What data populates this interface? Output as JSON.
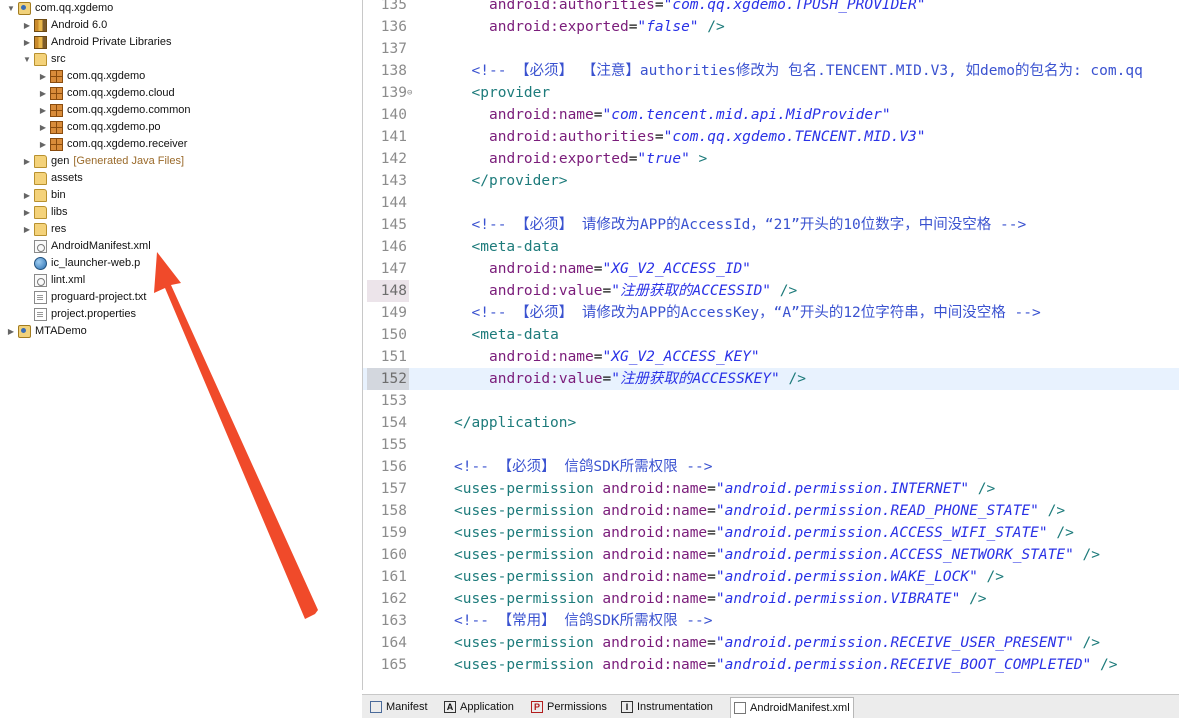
{
  "explorer": {
    "items": [
      {
        "label": "com.qq.xgdemo",
        "icon": "project-icon",
        "twisty": "open",
        "indent": 0
      },
      {
        "label": "Android 6.0",
        "icon": "library-icon",
        "twisty": "closed",
        "indent": 1
      },
      {
        "label": "Android Private Libraries",
        "icon": "library-icon",
        "twisty": "closed",
        "indent": 1
      },
      {
        "label": "src",
        "icon": "source-folder-icon",
        "twisty": "open",
        "indent": 1
      },
      {
        "label": "com.qq.xgdemo",
        "icon": "package-icon",
        "twisty": "closed",
        "indent": 2
      },
      {
        "label": "com.qq.xgdemo.cloud",
        "icon": "package-icon",
        "twisty": "closed",
        "indent": 2
      },
      {
        "label": "com.qq.xgdemo.common",
        "icon": "package-icon",
        "twisty": "closed",
        "indent": 2
      },
      {
        "label": "com.qq.xgdemo.po",
        "icon": "package-icon",
        "twisty": "closed",
        "indent": 2
      },
      {
        "label": "com.qq.xgdemo.receiver",
        "icon": "package-icon",
        "twisty": "closed",
        "indent": 2
      },
      {
        "label": "gen",
        "decoration": "[Generated Java Files]",
        "icon": "source-folder-icon",
        "twisty": "closed",
        "indent": 1
      },
      {
        "label": "assets",
        "icon": "folder-icon",
        "twisty": "none",
        "indent": 1
      },
      {
        "label": "bin",
        "icon": "folder-icon",
        "twisty": "closed",
        "indent": 1
      },
      {
        "label": "libs",
        "icon": "folder-icon",
        "twisty": "closed",
        "indent": 1
      },
      {
        "label": "res",
        "icon": "folder-icon",
        "twisty": "closed",
        "indent": 1
      },
      {
        "label": "AndroidManifest.xml",
        "icon": "xml-file-icon",
        "twisty": "none",
        "indent": 1
      },
      {
        "label": "ic_launcher-web.p",
        "icon": "image-file-icon",
        "twisty": "none",
        "indent": 1
      },
      {
        "label": "lint.xml",
        "icon": "xml-file-icon",
        "twisty": "none",
        "indent": 1
      },
      {
        "label": "proguard-project.txt",
        "icon": "text-file-icon",
        "twisty": "none",
        "indent": 1
      },
      {
        "label": "project.properties",
        "icon": "text-file-icon",
        "twisty": "none",
        "indent": 1
      },
      {
        "label": "MTADemo",
        "icon": "project-icon",
        "twisty": "closed",
        "indent": 0
      }
    ]
  },
  "annotation": {
    "color": "#f04a2a"
  },
  "editor": {
    "lines": [
      {
        "n": "135",
        "indent": 8,
        "tokens": [
          [
            "attr",
            "android:authorities"
          ],
          [
            "txt",
            "="
          ],
          [
            "val",
            "\"com.qq.xgdemo.TPUSH_PROVIDER\""
          ]
        ]
      },
      {
        "n": "136",
        "indent": 8,
        "tokens": [
          [
            "attr",
            "android:exported"
          ],
          [
            "txt",
            "="
          ],
          [
            "val",
            "\"false\""
          ],
          [
            "tag",
            " />"
          ]
        ]
      },
      {
        "n": "137",
        "indent": 0,
        "tokens": []
      },
      {
        "n": "138",
        "indent": 6,
        "tokens": [
          [
            "com",
            "<!-- 【必须】 【注意】authorities修改为 包名.TENCENT.MID.V3, 如demo的包名为: com.qq"
          ]
        ]
      },
      {
        "n": "139",
        "indent": 6,
        "fold": true,
        "tokens": [
          [
            "tag",
            "<provider"
          ]
        ]
      },
      {
        "n": "140",
        "indent": 8,
        "tokens": [
          [
            "attr",
            "android:name"
          ],
          [
            "txt",
            "="
          ],
          [
            "val",
            "\"com.tencent.mid.api.MidProvider\""
          ]
        ]
      },
      {
        "n": "141",
        "indent": 8,
        "tokens": [
          [
            "attr",
            "android:authorities"
          ],
          [
            "txt",
            "="
          ],
          [
            "val",
            "\"com.qq.xgdemo.TENCENT.MID.V3\""
          ]
        ]
      },
      {
        "n": "142",
        "indent": 8,
        "tokens": [
          [
            "attr",
            "android:exported"
          ],
          [
            "txt",
            "="
          ],
          [
            "val",
            "\"true\""
          ],
          [
            "tag",
            " >"
          ]
        ]
      },
      {
        "n": "143",
        "indent": 6,
        "tokens": [
          [
            "tag",
            "</provider>"
          ]
        ]
      },
      {
        "n": "144",
        "indent": 0,
        "tokens": []
      },
      {
        "n": "145",
        "indent": 6,
        "tokens": [
          [
            "com",
            "<!-- 【必须】 请修改为APP的AccessId，“21”开头的10位数字，中间没空格 -->"
          ]
        ]
      },
      {
        "n": "146",
        "indent": 6,
        "tokens": [
          [
            "tag",
            "<meta-data"
          ]
        ]
      },
      {
        "n": "147",
        "indent": 8,
        "tokens": [
          [
            "attr",
            "android:name"
          ],
          [
            "txt",
            "="
          ],
          [
            "val",
            "\"XG_V2_ACCESS_ID\""
          ]
        ]
      },
      {
        "n": "148",
        "indent": 8,
        "hl": true,
        "tokens": [
          [
            "attr",
            "android:value"
          ],
          [
            "txt",
            "="
          ],
          [
            "val",
            "\"注册获取的ACCESSID\""
          ],
          [
            "tag",
            " />"
          ]
        ]
      },
      {
        "n": "149",
        "indent": 6,
        "tokens": [
          [
            "com",
            "<!-- 【必须】 请修改为APP的AccessKey，“A”开头的12位字符串，中间没空格 -->"
          ]
        ]
      },
      {
        "n": "150",
        "indent": 6,
        "tokens": [
          [
            "tag",
            "<meta-data"
          ]
        ]
      },
      {
        "n": "151",
        "indent": 8,
        "tokens": [
          [
            "attr",
            "android:name"
          ],
          [
            "txt",
            "="
          ],
          [
            "val",
            "\"XG_V2_ACCESS_KEY\""
          ]
        ]
      },
      {
        "n": "152",
        "indent": 8,
        "current": true,
        "tokens": [
          [
            "attr",
            "android:value"
          ],
          [
            "txt",
            "="
          ],
          [
            "val",
            "\"注册获取的ACCESSKEY\""
          ],
          [
            "tag",
            " />"
          ]
        ]
      },
      {
        "n": "153",
        "indent": 0,
        "tokens": []
      },
      {
        "n": "154",
        "indent": 4,
        "tokens": [
          [
            "tag",
            "</application>"
          ]
        ]
      },
      {
        "n": "155",
        "indent": 0,
        "tokens": []
      },
      {
        "n": "156",
        "indent": 4,
        "tokens": [
          [
            "com",
            "<!-- 【必须】 信鸽SDK所需权限 -->"
          ]
        ]
      },
      {
        "n": "157",
        "indent": 4,
        "tokens": [
          [
            "tag",
            "<uses-permission "
          ],
          [
            "attr",
            "android:name"
          ],
          [
            "txt",
            "="
          ],
          [
            "val",
            "\"android.permission.INTERNET\""
          ],
          [
            "tag",
            " />"
          ]
        ]
      },
      {
        "n": "158",
        "indent": 4,
        "tokens": [
          [
            "tag",
            "<uses-permission "
          ],
          [
            "attr",
            "android:name"
          ],
          [
            "txt",
            "="
          ],
          [
            "val",
            "\"android.permission.READ_PHONE_STATE\""
          ],
          [
            "tag",
            " />"
          ]
        ]
      },
      {
        "n": "159",
        "indent": 4,
        "tokens": [
          [
            "tag",
            "<uses-permission "
          ],
          [
            "attr",
            "android:name"
          ],
          [
            "txt",
            "="
          ],
          [
            "val",
            "\"android.permission.ACCESS_WIFI_STATE\""
          ],
          [
            "tag",
            " />"
          ]
        ]
      },
      {
        "n": "160",
        "indent": 4,
        "tokens": [
          [
            "tag",
            "<uses-permission "
          ],
          [
            "attr",
            "android:name"
          ],
          [
            "txt",
            "="
          ],
          [
            "val",
            "\"android.permission.ACCESS_NETWORK_STATE\""
          ],
          [
            "tag",
            " />"
          ]
        ]
      },
      {
        "n": "161",
        "indent": 4,
        "tokens": [
          [
            "tag",
            "<uses-permission "
          ],
          [
            "attr",
            "android:name"
          ],
          [
            "txt",
            "="
          ],
          [
            "val",
            "\"android.permission.WAKE_LOCK\""
          ],
          [
            "tag",
            " />"
          ]
        ]
      },
      {
        "n": "162",
        "indent": 4,
        "tokens": [
          [
            "tag",
            "<uses-permission "
          ],
          [
            "attr",
            "android:name"
          ],
          [
            "txt",
            "="
          ],
          [
            "val",
            "\"android.permission.VIBRATE\""
          ],
          [
            "tag",
            " />"
          ]
        ]
      },
      {
        "n": "163",
        "indent": 4,
        "tokens": [
          [
            "com",
            "<!-- 【常用】 信鸽SDK所需权限 -->"
          ]
        ]
      },
      {
        "n": "164",
        "indent": 4,
        "tokens": [
          [
            "tag",
            "<uses-permission "
          ],
          [
            "attr",
            "android:name"
          ],
          [
            "txt",
            "="
          ],
          [
            "val",
            "\"android.permission.RECEIVE_USER_PRESENT\""
          ],
          [
            "tag",
            " />"
          ]
        ]
      },
      {
        "n": "165",
        "indent": 4,
        "tokens": [
          [
            "tag",
            "<uses-permission "
          ],
          [
            "attr",
            "android:name"
          ],
          [
            "txt",
            "="
          ],
          [
            "val",
            "\"android.permission.RECEIVE_BOOT_COMPLETED\""
          ],
          [
            "tag",
            " />"
          ]
        ]
      }
    ]
  },
  "tabs": {
    "manifest": "Manifest",
    "application": "Application",
    "application_glyph": "A",
    "permissions": "Permissions",
    "permissions_glyph": "P",
    "instrumentation": "Instrumentation",
    "instrumentation_glyph": "I",
    "xml": "AndroidManifest.xml"
  }
}
